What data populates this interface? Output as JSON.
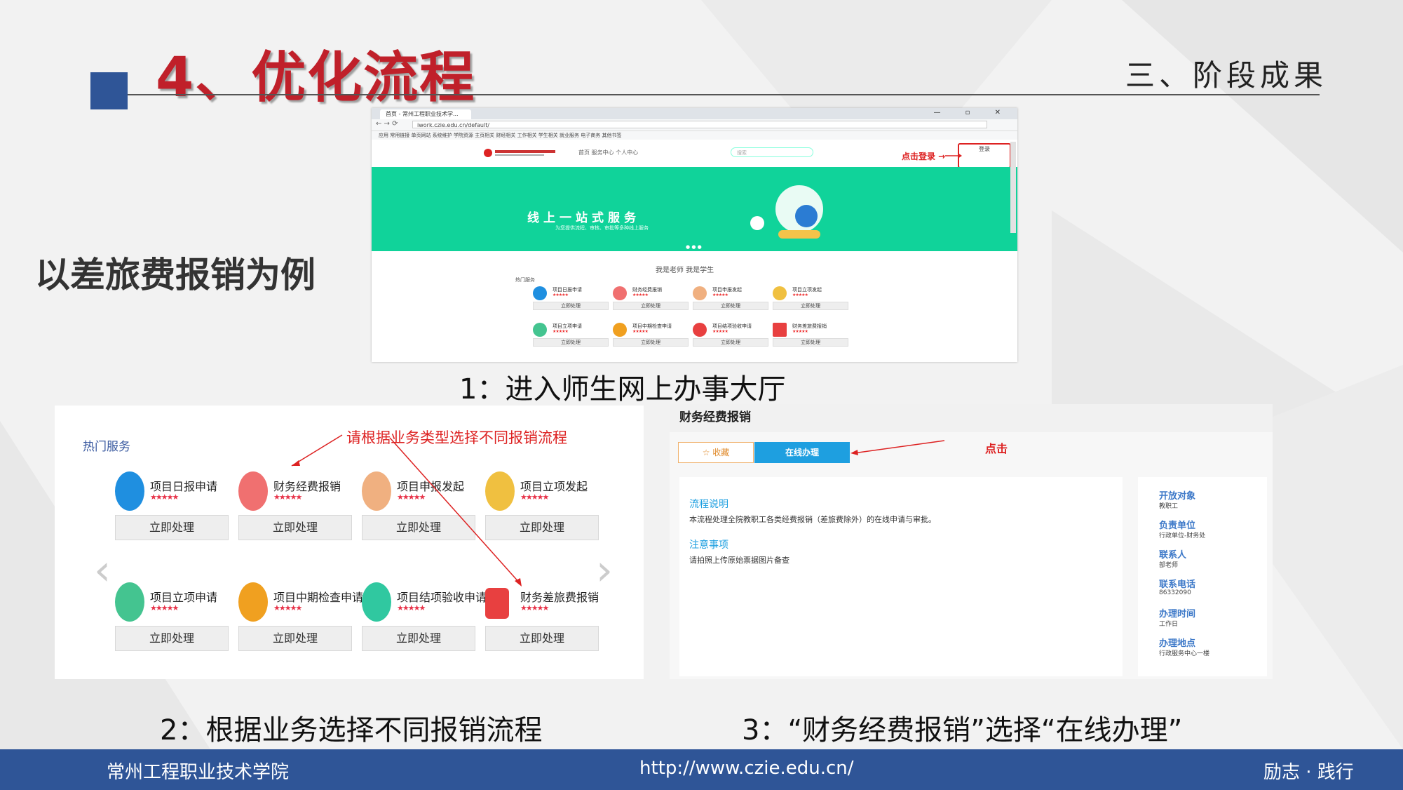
{
  "slide": {
    "title": "4、优化流程",
    "section": "三、阶段成果",
    "side_label": "以差旅费报销为例",
    "captions": {
      "step1": "1：进入师生网上办事大厅",
      "step2": "2：根据业务选择不同报销流程",
      "step3": "3：“财务经费报销”选择“在线办理”"
    },
    "footer": {
      "school": "常州工程职业技术学院",
      "url": "http://www.czie.edu.cn/",
      "motto": "励志 · 践行"
    },
    "colors": {
      "accent_blue": "#2f5597",
      "title_red": "#c0202a",
      "annotation_red": "#dd2222",
      "banner_green": "#10d39a",
      "button_blue": "#1e9fe0"
    }
  },
  "browser": {
    "tab_label": "首页 - 常州工程职业技术学...",
    "url": "iwork.czie.edu.cn/default/",
    "window_buttons": "— ▫ ✕",
    "bookmarks": "应用  常用链接  单页网站  系统维护  学院资源  主页相关  财经相关  工作相关  学生相关  就业服务  电子商务  其他书签",
    "site_nav": "首页    服务中心    个人中心",
    "search_placeholder": "搜索",
    "login_note": "点击登录 →",
    "login_label": "登录",
    "banner_title": "线上一站式服务",
    "banner_sub": "为您提供流程、审核、审批等多种线上服务",
    "portal_tabs": "我是老师   我是学生",
    "hot_label": "热门服务",
    "services": [
      {
        "name": "项目日报申请",
        "btn": "立即处理"
      },
      {
        "name": "财务经费报销",
        "btn": "立即处理"
      },
      {
        "name": "项目申报发起",
        "btn": "立即处理"
      },
      {
        "name": "项目立项发起",
        "btn": "立即处理"
      },
      {
        "name": "项目立项申请",
        "btn": "立即处理"
      },
      {
        "name": "项目中期检查申请",
        "btn": "立即处理"
      },
      {
        "name": "项目结项验收申请",
        "btn": "立即处理"
      },
      {
        "name": "财务差旅费报销",
        "btn": "立即处理"
      }
    ],
    "stars": "★★★★★"
  },
  "hot_services": {
    "title": "热门服务",
    "annotation": "请根据业务类型选择不同报销流程",
    "items": [
      {
        "name": "项目日报申请",
        "btn": "立即处理",
        "color": "#1f8fe0"
      },
      {
        "name": "财务经费报销",
        "btn": "立即处理",
        "color": "#f07070"
      },
      {
        "name": "项目申报发起",
        "btn": "立即处理",
        "color": "#f0b080"
      },
      {
        "name": "项目立项发起",
        "btn": "立即处理",
        "color": "#f0c040"
      },
      {
        "name": "项目立项申请",
        "btn": "立即处理",
        "color": "#44c490"
      },
      {
        "name": "项目中期检查申请",
        "btn": "立即处理",
        "color": "#f0a020"
      },
      {
        "name": "项目结项验收申请",
        "btn": "立即处理",
        "color": "#30c8a0"
      },
      {
        "name": "财务差旅费报销",
        "btn": "立即处理",
        "color": "#e84040"
      }
    ],
    "stars": "★★★★★"
  },
  "finance": {
    "title": "财务经费报销",
    "fav_label": "☆ 收藏",
    "online_label": "在线办理",
    "annotation": "点击",
    "process_title": "流程说明",
    "process_text": "本流程处理全院教职工各类经费报销（差旅费除外）的在线申请与审批。",
    "notes_title": "注意事项",
    "notes_text": "请拍照上传原始票据图片备查",
    "sidebar": [
      {
        "label": "开放对象",
        "value": "教职工"
      },
      {
        "label": "负责单位",
        "value": "行政单位-财务处"
      },
      {
        "label": "联系人",
        "value": "部老师"
      },
      {
        "label": "联系电话",
        "value": "86332090"
      },
      {
        "label": "办理时间",
        "value": "工作日"
      },
      {
        "label": "办理地点",
        "value": "行政服务中心一楼"
      }
    ]
  }
}
